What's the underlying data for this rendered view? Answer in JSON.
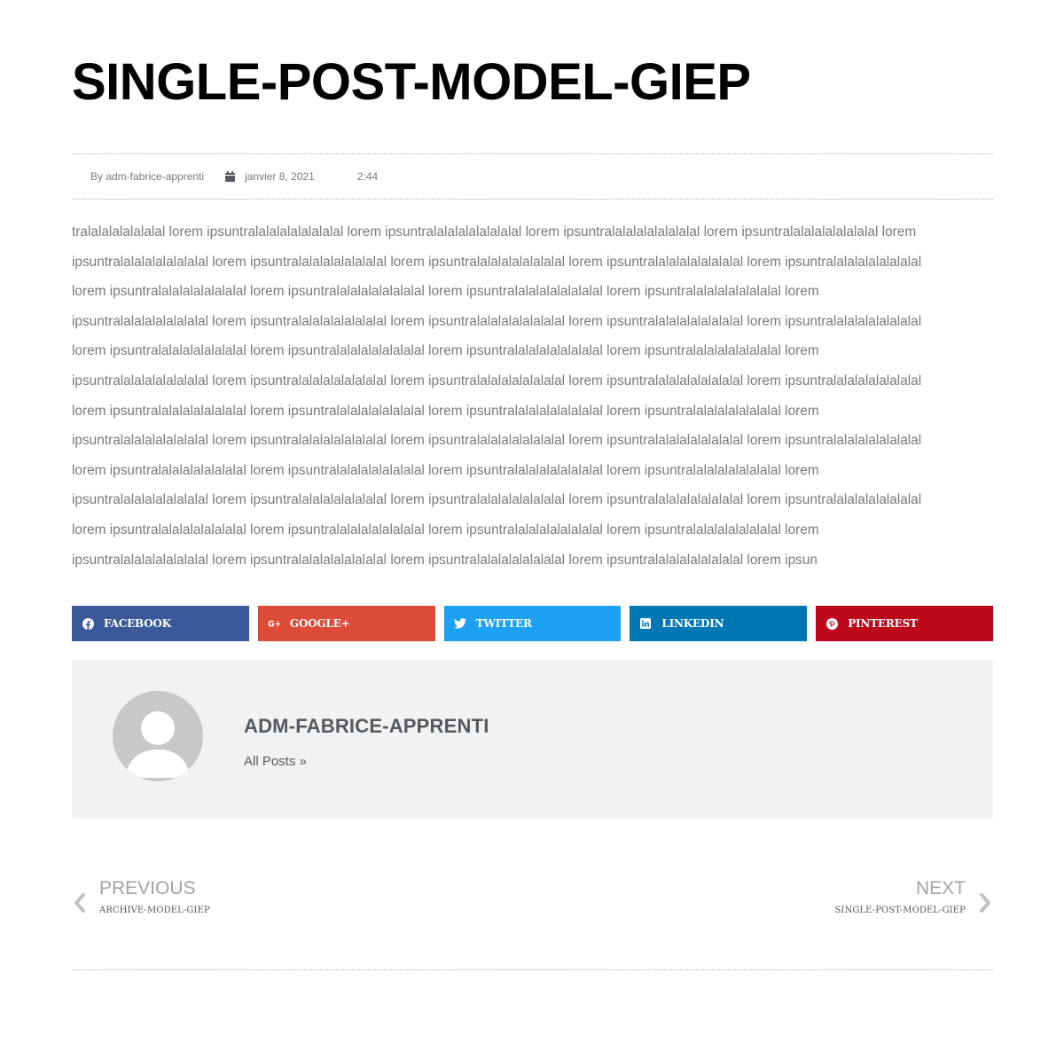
{
  "post": {
    "title": "SINGLE-POST-MODEL-GIEP",
    "meta": {
      "author": "By adm-fabrice-apprenti",
      "date": "janvier 8, 2021",
      "time": "2:44"
    },
    "body_lines": [
      "tralalalalalalalal lorem ipsuntralalalalalalalalal lorem ipsuntralalalalalalalalal lorem ipsuntralalalalalalalalal lorem ipsuntralalalalalalalalal lorem",
      "ipsuntralalalalalalalalal lorem ipsuntralalalalalalalalal lorem ipsuntralalalalalalalalal lorem ipsuntralalalalalalalalal lorem ipsuntralalalalalalalalal",
      "lorem ipsuntralalalalalalalalal lorem ipsuntralalalalalalalalal lorem ipsuntralalalalalalalalal lorem ipsuntralalalalalalalalal lorem",
      "ipsuntralalalalalalalalal lorem ipsuntralalalalalalalalal lorem ipsuntralalalalalalalalal lorem ipsuntralalalalalalalalal lorem ipsuntralalalalalalalalal",
      "lorem ipsuntralalalalalalalalal lorem ipsuntralalalalalalalalal lorem ipsuntralalalalalalalalal lorem ipsuntralalalalalalalalal lorem",
      "ipsuntralalalalalalalalal lorem ipsuntralalalalalalalalal lorem ipsuntralalalalalalalalal lorem ipsuntralalalalalalalalal lorem ipsuntralalalalalalalalal",
      "lorem ipsuntralalalalalalalalal lorem ipsuntralalalalalalalalal lorem ipsuntralalalalalalalalal lorem ipsuntralalalalalalalalal lorem",
      "ipsuntralalalalalalalalal lorem ipsuntralalalalalalalalal lorem ipsuntralalalalalalalalal lorem ipsuntralalalalalalalalal lorem ipsuntralalalalalalalalal",
      "lorem ipsuntralalalalalalalalal lorem ipsuntralalalalalalalalal lorem ipsuntralalalalalalalalal lorem ipsuntralalalalalalalalal lorem",
      "ipsuntralalalalalalalalal lorem ipsuntralalalalalalalalal lorem ipsuntralalalalalalalalal lorem ipsuntralalalalalalalalal lorem ipsuntralalalalalalalalal",
      "lorem ipsuntralalalalalalalalal lorem ipsuntralalalalalalalalal lorem ipsuntralalalalalalalalal lorem ipsuntralalalalalalalalal lorem",
      "ipsuntralalalalalalalalal lorem ipsuntralalalalalalalalal lorem ipsuntralalalalalalalalal lorem ipsuntralalalalalalalalal lorem ipsun"
    ]
  },
  "share": {
    "buttons": [
      {
        "label": "FACEBOOK",
        "icon": "facebook-icon",
        "color": "#3b5998"
      },
      {
        "label": "GOOGLE+",
        "icon": "google-plus-icon",
        "color": "#dd4b39"
      },
      {
        "label": "TWITTER",
        "icon": "twitter-icon",
        "color": "#1da1f2"
      },
      {
        "label": "LINKEDIN",
        "icon": "linkedin-icon",
        "color": "#0077b5"
      },
      {
        "label": "PINTEREST",
        "icon": "pinterest-icon",
        "color": "#bd081c"
      }
    ]
  },
  "author_box": {
    "name": "ADM-FABRICE-APPRENTI",
    "link": "All Posts »",
    "avatar_icon": "default-avatar-icon",
    "background": "#f2f2f2"
  },
  "post_nav": {
    "prev_label": "PREVIOUS",
    "prev_title": "ARCHIVE-MODEL-GIEP",
    "next_label": "NEXT",
    "next_title": "SINGLE-POST-MODEL-GIEP",
    "prev_icon": "chevron-left-icon",
    "next_icon": "chevron-right-icon"
  }
}
